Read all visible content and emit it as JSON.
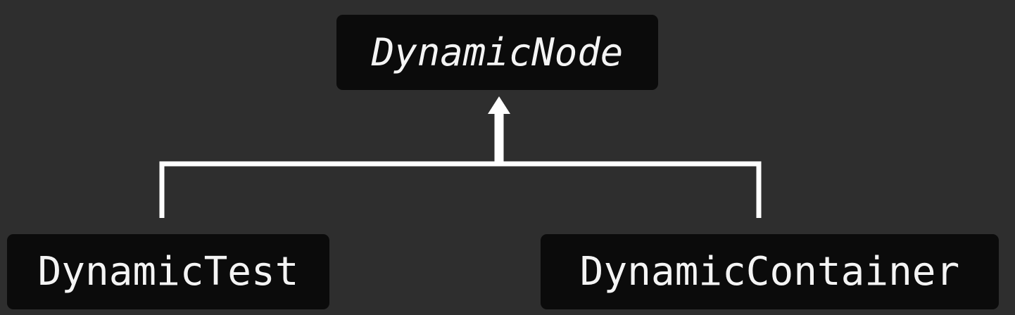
{
  "diagram": {
    "parent": {
      "label": "DynamicNode",
      "style": "italic"
    },
    "children": [
      {
        "label": "DynamicTest"
      },
      {
        "label": "DynamicContainer"
      }
    ],
    "relation": "inherits-from"
  },
  "colors": {
    "background": "#2e2e2e",
    "box": "#0b0b0b",
    "text": "#f4f4f4",
    "connector": "#ffffff"
  }
}
